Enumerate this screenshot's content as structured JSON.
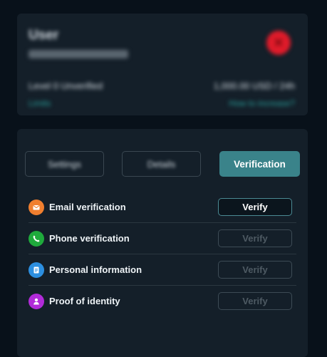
{
  "profile": {
    "title": "User",
    "level": "Level 0 Unverified",
    "balance": "1,000.00 USD / 24h",
    "link_left": "Limits",
    "link_right": "How to increase?"
  },
  "tabs": [
    {
      "label": "Settings",
      "active": false
    },
    {
      "label": "Details",
      "active": false
    },
    {
      "label": "Verification",
      "active": true
    }
  ],
  "verification_items": [
    {
      "label": "Email verification",
      "icon": "envelope-icon",
      "color": "#f07f2f",
      "button": "Verify",
      "enabled": true
    },
    {
      "label": "Phone verification",
      "icon": "phone-icon",
      "color": "#1faa3c",
      "button": "Verify",
      "enabled": false
    },
    {
      "label": "Personal information",
      "icon": "document-icon",
      "color": "#2c8fe0",
      "button": "Verify",
      "enabled": false
    },
    {
      "label": "Proof of identity",
      "icon": "person-icon",
      "color": "#b12bd8",
      "button": "Verify",
      "enabled": false
    }
  ]
}
